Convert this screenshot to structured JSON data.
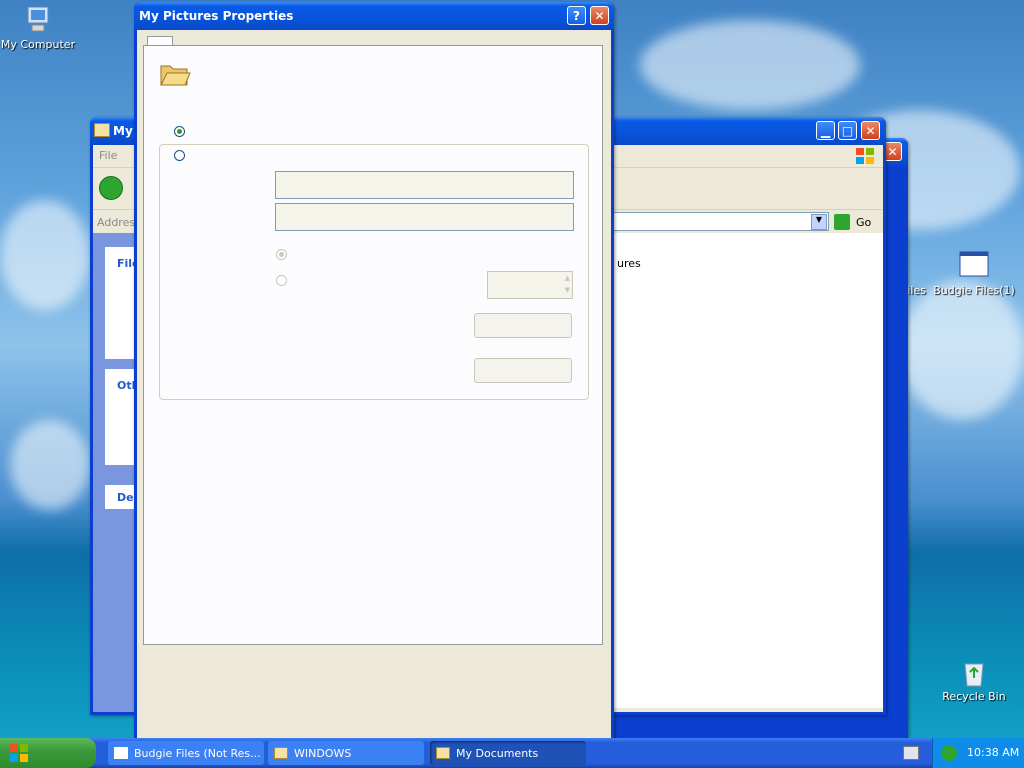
{
  "desktop": {
    "icons": [
      {
        "label": "My Computer"
      },
      {
        "label": "Budgie Files(1)"
      },
      {
        "label": "iles"
      },
      {
        "label": "Recycle Bin"
      }
    ]
  },
  "explorer_window": {
    "title_fragment": "My",
    "menu_file": "File",
    "address_label": "Addres",
    "go_label": "Go",
    "content_item": "ures",
    "tasks_sections": [
      "File",
      "Oth",
      "De"
    ]
  },
  "dialog": {
    "title": "My Pictures Properties",
    "help_button": "?",
    "close_button": "✕"
  },
  "taskbar": {
    "start_label": "",
    "items": [
      {
        "label": "Budgie Files (Not Res..."
      },
      {
        "label": "WINDOWS"
      },
      {
        "label": "My Documents"
      }
    ],
    "clock": "10:38 AM"
  },
  "colors": {
    "taskbar_blue": "#245edb",
    "start_green": "#3c9a3c",
    "tray_blue": "#0f8ce8",
    "dialog_face": "#ece9d8"
  }
}
